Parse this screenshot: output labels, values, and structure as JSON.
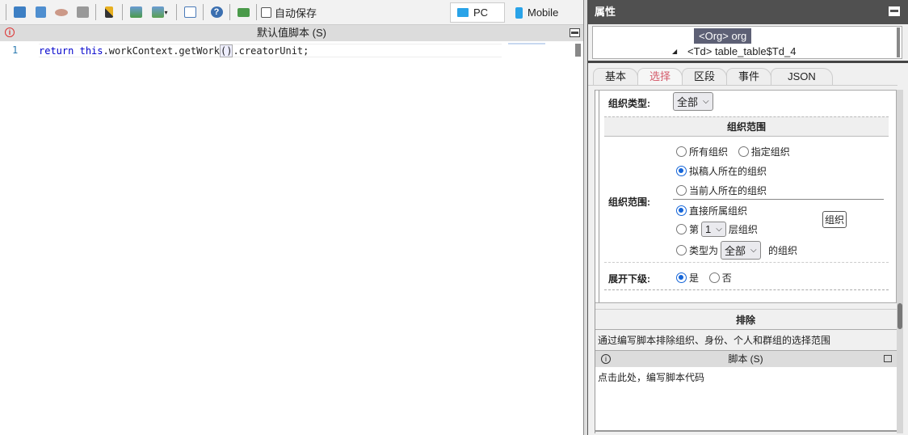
{
  "toolbar": {
    "autosave_label": "自动保存",
    "pc_label": "PC",
    "mobile_label": "Mobile"
  },
  "editor": {
    "title": "默认值脚本 (S)",
    "line_number": "1",
    "code_kw1": "return",
    "code_kw2": "this",
    "code_rest1": ".workContext.getWork",
    "code_paren": "()",
    "code_rest2": ".creatorUnit;"
  },
  "properties": {
    "title": "属性",
    "tree_selected": "<Org> org",
    "tree_item": "<Td> table_table$Td_4",
    "tabs": [
      "基本",
      "选择",
      "区段",
      "事件",
      "JSON"
    ],
    "org_type_label": "组织类型:",
    "org_type_value": "全部",
    "scope_header": "组织范围",
    "scope_label": "组织范围:",
    "opt_all": "所有组织",
    "opt_specified": "指定组织",
    "opt_drafter": "拟稿人所在的组织",
    "opt_current": "当前人所在的组织",
    "opt_direct": "直接所属组织",
    "opt_level_prefix": "第",
    "level_value": "1",
    "opt_level_suffix": "层组织",
    "opt_type_prefix": "类型为",
    "type_value": "全部",
    "opt_type_suffix": "的组织",
    "org_button": "组织",
    "expand_label": "展开下级:",
    "expand_yes": "是",
    "expand_no": "否",
    "exclude_header": "排除",
    "exclude_desc": "通过编写脚本排除组织、身份、个人和群组的选择范围",
    "script_title": "脚本 (S)",
    "script_placeholder": "点击此处，编写脚本代码"
  }
}
